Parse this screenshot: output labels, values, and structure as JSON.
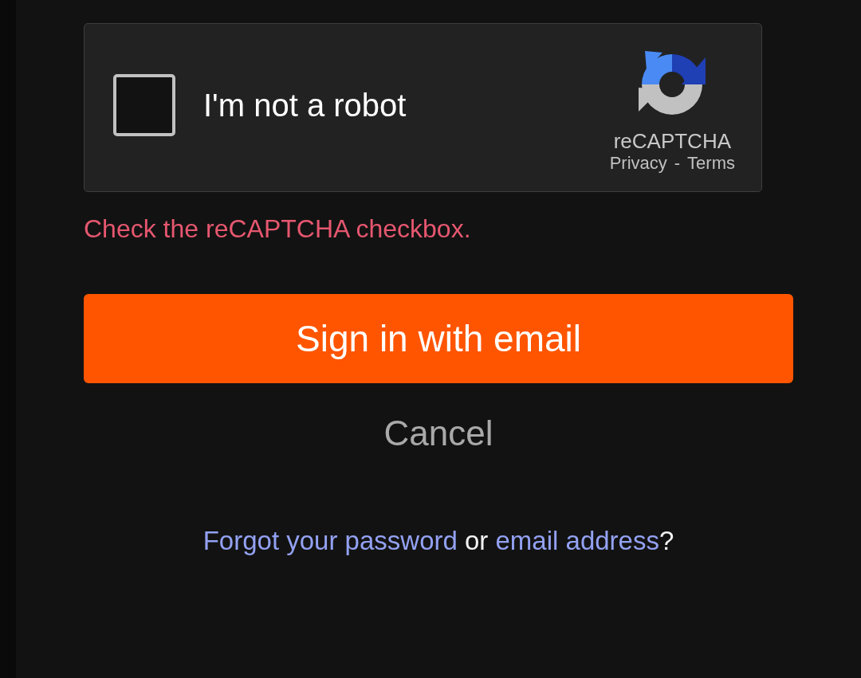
{
  "captcha": {
    "checked": false,
    "label": "I'm not a robot",
    "brand": "reCAPTCHA",
    "links": [
      "Privacy",
      "Terms"
    ],
    "separator": "-"
  },
  "error": "Check the reCAPTCHA checkbox.",
  "buttons": [
    {
      "label": "Sign in with email",
      "kind": "primary"
    },
    {
      "label": "Cancel",
      "kind": "plain"
    }
  ],
  "help": [
    {
      "text": "Forgot your password",
      "kind": "link"
    },
    {
      "text": " or ",
      "kind": "text"
    },
    {
      "text": "email address",
      "kind": "link"
    },
    {
      "text": "?",
      "kind": "text"
    }
  ]
}
